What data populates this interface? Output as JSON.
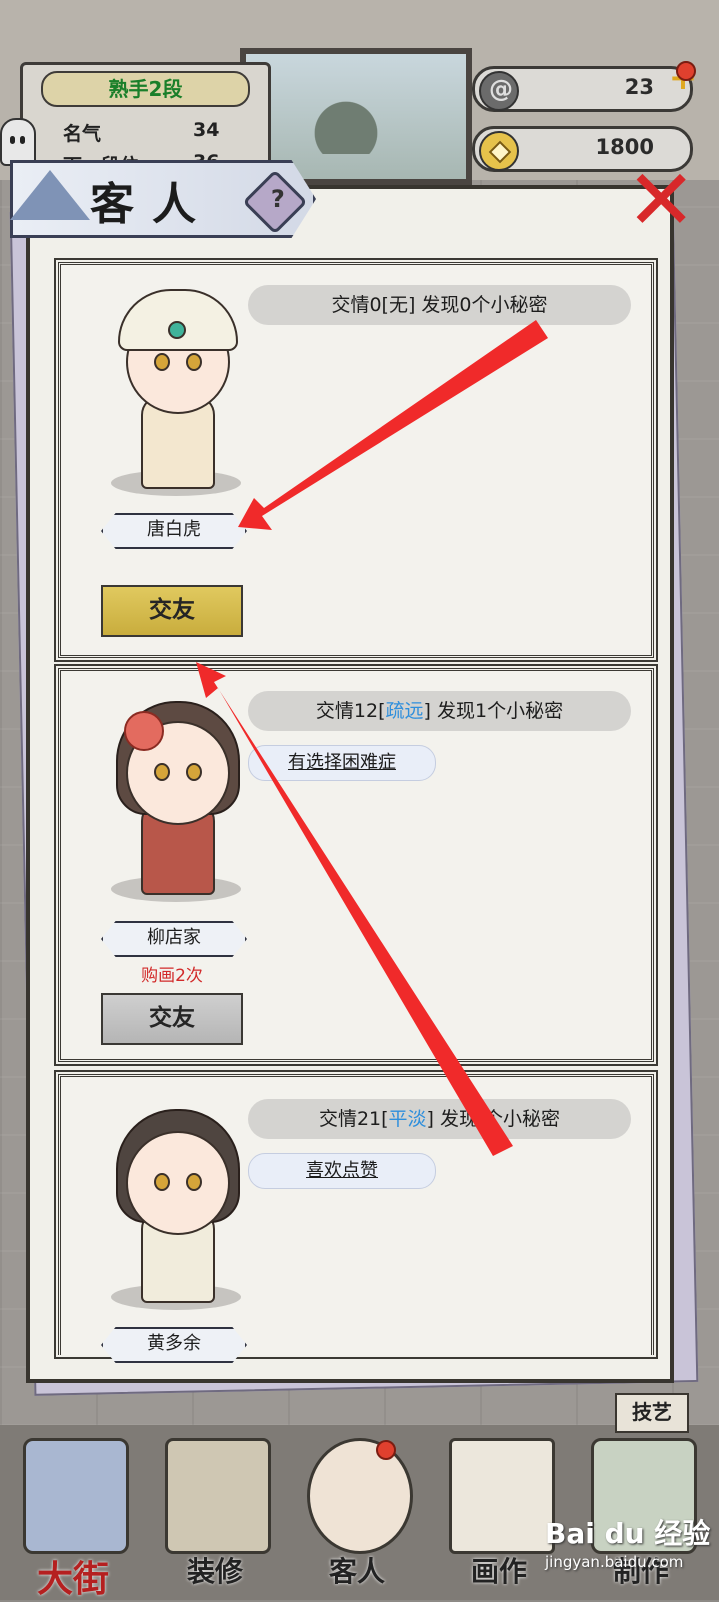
{
  "rank": {
    "title": "熟手2段",
    "fame_label": "名气",
    "fame_value": "34",
    "next_label": "下一段位",
    "next_value": "36"
  },
  "currency": {
    "scrolls": "23",
    "coins": "1800"
  },
  "dialog": {
    "title": "客人",
    "help_symbol": "?",
    "close_symbol": "✕"
  },
  "guests": [
    {
      "name": "唐白虎",
      "relation_prefix": "交情0[",
      "relation_level": "无",
      "relation_suffix": "] 发现0个小秘密",
      "trait": "",
      "purchase": "",
      "button": "交友"
    },
    {
      "name": "柳店家",
      "relation_prefix": "交情12[",
      "relation_level": "疏远",
      "relation_suffix": "] 发现1个小秘密",
      "trait": "有选择困难症",
      "purchase": "购画2次",
      "button": "交友"
    },
    {
      "name": "黄多余",
      "relation_prefix": "交情21[",
      "relation_level": "平淡",
      "relation_suffix": "] 发现 个小秘密",
      "trait": "喜欢点赞",
      "purchase": "",
      "button": ""
    }
  ],
  "skill_label": "技艺",
  "nav": [
    "大街",
    "装修",
    "客人",
    "画作",
    "制作"
  ],
  "watermark": {
    "brand": "Bai du 经验",
    "url": "jingyan.baidu.com"
  },
  "colors": {
    "friend_button_active": "#d6be4e",
    "friend_button_inactive": "#c2c2c2",
    "relation_blue": "#2f8fdc",
    "purchase_red": "#d22a2a",
    "arrow_red": "#f02a2a",
    "rank_green": "#1a7f2a"
  }
}
